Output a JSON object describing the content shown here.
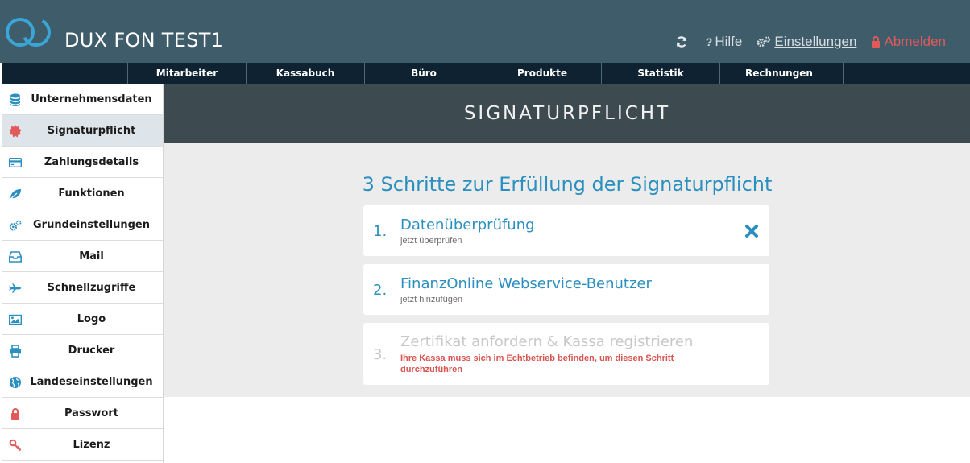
{
  "app": {
    "title": "DUX FON TEST1"
  },
  "header": {
    "refresh_icon": "refresh-icon",
    "help_label": "Hilfe",
    "settings_label": "Einstellungen",
    "logout_label": "Abmelden"
  },
  "topnav": {
    "items": [
      {
        "label": "Mitarbeiter"
      },
      {
        "label": "Kassabuch"
      },
      {
        "label": "Büro"
      },
      {
        "label": "Produkte"
      },
      {
        "label": "Statistik"
      },
      {
        "label": "Rechnungen"
      }
    ]
  },
  "sidebar": {
    "items": [
      {
        "label": "Unternehmensdaten",
        "icon": "database-icon"
      },
      {
        "label": "Signaturpflicht",
        "icon": "seal-icon",
        "active": true
      },
      {
        "label": "Zahlungsdetails",
        "icon": "credit-card-icon"
      },
      {
        "label": "Funktionen",
        "icon": "leaf-icon"
      },
      {
        "label": "Grundeinstellungen",
        "icon": "gears-icon"
      },
      {
        "label": "Mail",
        "icon": "inbox-icon"
      },
      {
        "label": "Schnellzugriffe",
        "icon": "plane-icon"
      },
      {
        "label": "Logo",
        "icon": "image-icon"
      },
      {
        "label": "Drucker",
        "icon": "printer-icon"
      },
      {
        "label": "Landeseinstellungen",
        "icon": "globe-icon"
      },
      {
        "label": "Passwort",
        "icon": "lock-icon"
      },
      {
        "label": "Lizenz",
        "icon": "key-icon"
      }
    ]
  },
  "main": {
    "title": "SIGNATURPFLICHT",
    "heading": "3 Schritte zur Erfüllung der Signaturpflicht",
    "steps": [
      {
        "number": "1.",
        "title": "Datenüberprüfung",
        "subtitle": "jetzt überprüfen",
        "status_icon": "close-icon"
      },
      {
        "number": "2.",
        "title": "FinanzOnline Webservice-Benutzer",
        "subtitle": "jetzt hinzufügen"
      },
      {
        "number": "3.",
        "title": "Zertifikat anfordern & Kassa registrieren",
        "warning": "Ihre Kassa muss sich im Echtbetrieb befinden, um diesen Schritt durchzuführen",
        "disabled": true
      }
    ]
  },
  "colors": {
    "header_bg": "#3f5c6b",
    "nav_bg": "#0e2232",
    "accent": "#2b8fbf",
    "danger": "#d9534f",
    "band_bg": "#3d4a4f"
  }
}
